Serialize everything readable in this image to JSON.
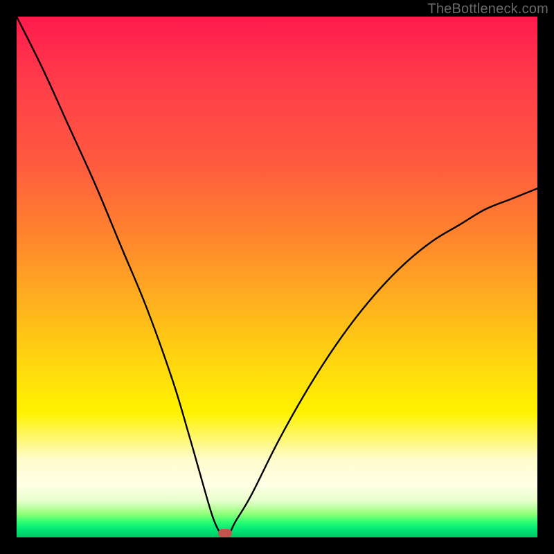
{
  "watermark": "TheBottleneck.com",
  "chart_data": {
    "type": "line",
    "title": "",
    "xlabel": "",
    "ylabel": "",
    "xlim": [
      0,
      100
    ],
    "ylim": [
      0,
      100
    ],
    "grid": false,
    "legend": false,
    "series": [
      {
        "name": "bottleneck-curve",
        "x": [
          0,
          5,
          10,
          15,
          20,
          25,
          30,
          33,
          35,
          37,
          38,
          39,
          40,
          41,
          42,
          45,
          50,
          55,
          60,
          65,
          70,
          75,
          80,
          85,
          90,
          95,
          100
        ],
        "y": [
          100,
          90,
          79,
          68,
          56,
          44,
          30,
          20,
          13,
          6,
          3,
          1,
          0,
          1,
          3,
          8,
          18,
          27,
          35,
          42,
          48,
          53,
          57,
          60,
          63,
          65,
          67
        ]
      }
    ],
    "marker": {
      "x": 40,
      "y": 0,
      "color": "#c1554e"
    },
    "background_gradient": {
      "stops": [
        {
          "pos": 0,
          "color": "#ff1a4d"
        },
        {
          "pos": 0.42,
          "color": "#ff842e"
        },
        {
          "pos": 0.76,
          "color": "#fff200"
        },
        {
          "pos": 0.97,
          "color": "#2fff73"
        },
        {
          "pos": 1.0,
          "color": "#00c864"
        }
      ]
    }
  }
}
